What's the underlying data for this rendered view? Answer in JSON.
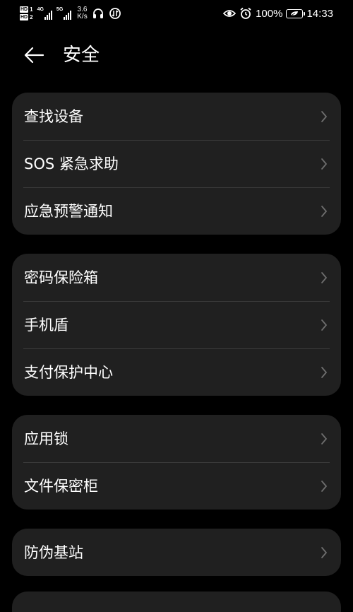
{
  "status_bar": {
    "sim1_label": "HD",
    "sim1_num": "1",
    "sim2_label": "HD",
    "sim2_num": "2",
    "net1_type": "4G",
    "net2_type": "5G",
    "speed_value": "3.6",
    "speed_unit": "K/s",
    "battery_percent": "100%",
    "time": "14:33",
    "icons": [
      "headphones-icon",
      "data-saver-icon",
      "eye-comfort-icon",
      "alarm-icon",
      "battery-icon"
    ]
  },
  "header": {
    "title": "安全",
    "back_icon": "arrow-left-icon"
  },
  "groups": [
    {
      "items": [
        {
          "label": "查找设备"
        },
        {
          "label": "SOS 紧急求助"
        },
        {
          "label": "应急预警通知"
        }
      ]
    },
    {
      "items": [
        {
          "label": "密码保险箱"
        },
        {
          "label": "手机盾"
        },
        {
          "label": "支付保护中心"
        }
      ]
    },
    {
      "items": [
        {
          "label": "应用锁"
        },
        {
          "label": "文件保密柜"
        }
      ]
    },
    {
      "items": [
        {
          "label": "防伪基站"
        }
      ]
    }
  ],
  "colors": {
    "background": "#000000",
    "card": "#202020",
    "divider": "#3a3a3a",
    "text": "#ffffff",
    "chevron": "#6e6e6e"
  }
}
